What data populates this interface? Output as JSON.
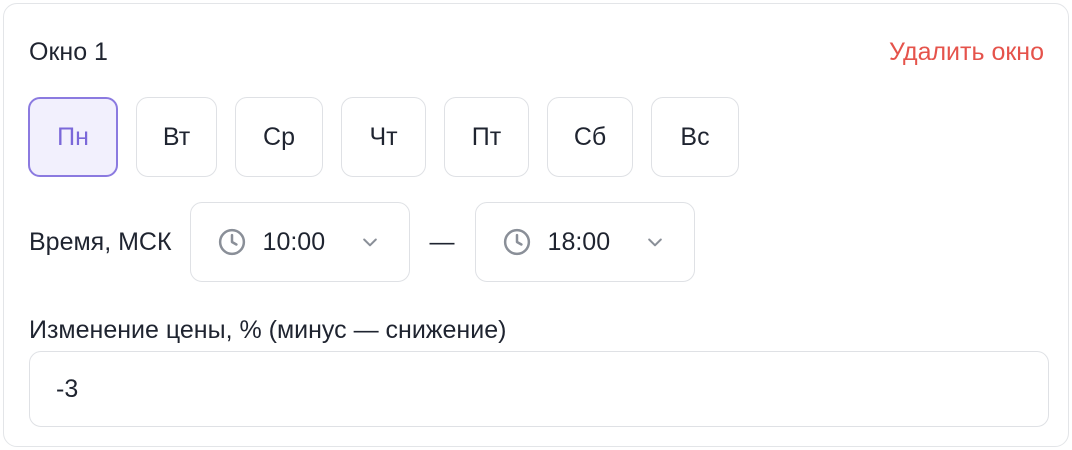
{
  "window": {
    "title": "Окно 1",
    "delete_label": "Удалить окно"
  },
  "days": [
    {
      "label": "Пн",
      "selected": true
    },
    {
      "label": "Вт",
      "selected": false
    },
    {
      "label": "Ср",
      "selected": false
    },
    {
      "label": "Чт",
      "selected": false
    },
    {
      "label": "Пт",
      "selected": false
    },
    {
      "label": "Сб",
      "selected": false
    },
    {
      "label": "Вс",
      "selected": false
    }
  ],
  "time": {
    "label": "Время, МСК",
    "separator": "—",
    "start": "10:00",
    "end": "18:00",
    "icons": {
      "clock": "clock-icon",
      "dropdown": "chevron-down-icon"
    }
  },
  "price": {
    "label": "Изменение цены, % (минус — снижение)",
    "value": "-3"
  },
  "colors": {
    "accent": "#7b68d9",
    "accent_bg": "#f2f0fd",
    "danger": "#e5534b",
    "border": "#dfe1e5",
    "text": "#1f2430",
    "icon": "#8a8f98"
  }
}
